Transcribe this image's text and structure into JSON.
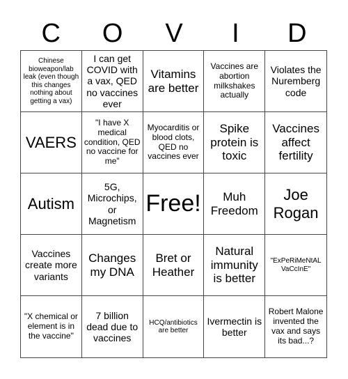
{
  "header": [
    "C",
    "O",
    "V",
    "I",
    "D"
  ],
  "cells": [
    {
      "text": "Chinese bioweapon/lab leak (even though this changes nothing about getting a vax)",
      "size": "s-xs"
    },
    {
      "text": "I can get COVID with a vax, QED no vaccines ever",
      "size": "s-md"
    },
    {
      "text": "Vitamins are better",
      "size": "s-lg"
    },
    {
      "text": "Vaccines are abortion milkshakes actually",
      "size": "s-sm"
    },
    {
      "text": "Violates the Nuremberg code",
      "size": "s-md"
    },
    {
      "text": "VAERS",
      "size": "s-xl"
    },
    {
      "text": "\"I have X medical condition, QED no vaccine for me\"",
      "size": "s-sm"
    },
    {
      "text": "Myocarditis or blood clots, QED no vaccines ever",
      "size": "s-sm"
    },
    {
      "text": "Spike protein is toxic",
      "size": "s-lg"
    },
    {
      "text": "Vaccines affect fertility",
      "size": "s-lg"
    },
    {
      "text": "Autism",
      "size": "s-xl"
    },
    {
      "text": "5G, Microchips, or Magnetism",
      "size": "s-md"
    },
    {
      "text": "Free!",
      "size": "s-xxl"
    },
    {
      "text": "Muh Freedom",
      "size": "s-lg"
    },
    {
      "text": "Joe Rogan",
      "size": "s-xl"
    },
    {
      "text": "Vaccines create more variants",
      "size": "s-md"
    },
    {
      "text": "Changes my DNA",
      "size": "s-lg"
    },
    {
      "text": "Bret or Heather",
      "size": "s-lg"
    },
    {
      "text": "Natural immunity is better",
      "size": "s-lg"
    },
    {
      "text": "\"ExPeRiMeNtAL VaCcInE\"",
      "size": "s-xs"
    },
    {
      "text": "\"X chemical or element is in the vaccine\"",
      "size": "s-sm"
    },
    {
      "text": "7 billion dead due to vaccines",
      "size": "s-md"
    },
    {
      "text": "HCQ/antibiotics are better",
      "size": "s-xs"
    },
    {
      "text": "Ivermectin is better",
      "size": "s-md"
    },
    {
      "text": "Robert Malone invented the vax and says its bad...?",
      "size": "s-sm"
    }
  ]
}
